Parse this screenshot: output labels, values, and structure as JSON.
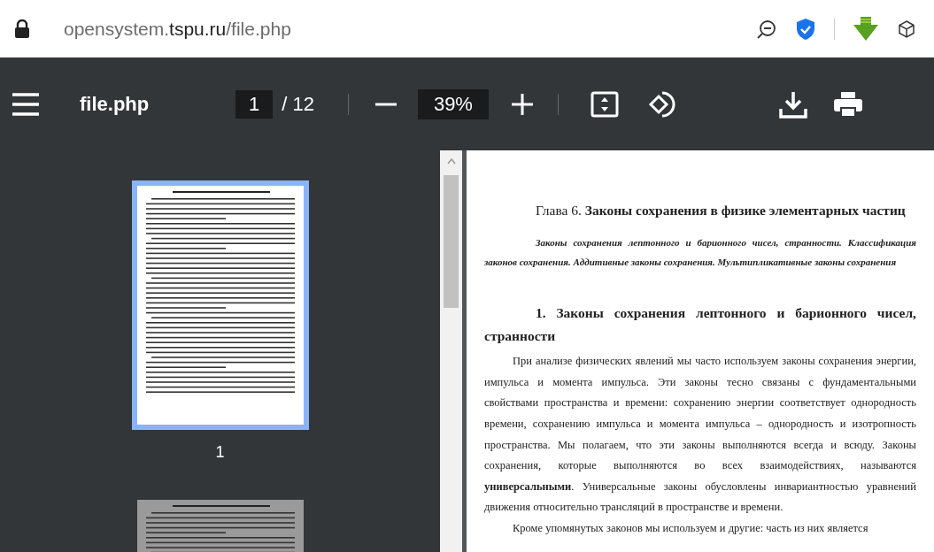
{
  "address_bar": {
    "url_host_prefix": "opensystem.",
    "url_domain": "tspu.ru",
    "url_path": "/file.php"
  },
  "toolbar": {
    "title": "file.php",
    "page_input": "1",
    "page_total": "/ 12",
    "zoom": "39%"
  },
  "thumbnails": [
    {
      "label": "1",
      "selected": true
    },
    {
      "selected": false
    }
  ],
  "document": {
    "heading": "Глава 6. **Законы сохранения в физике элементарных частиц**",
    "abstract": "Законы сохранения лептонного и барионного чисел, странности. Классификация законов сохранения. Аддитивные законы сохранения. Мультипликативные законы сохранения",
    "section_title": "1. Законы сохранения лептонного и барионного чисел, странности",
    "paragraphs": [
      "При анализе физических явлений мы часто используем законы сохранения энергии, импульса и момента импульса. Эти законы тесно связаны с фундаментальными свойствами пространства и времени: сохранению энергии соответствует однородность времени, сохранению импульса и момента импульса – однородность и изотропность пространства. Мы полагаем, что эти законы выполняются всегда и всюду. Законы сохранения, которые выполняются во всех взаимодействиях, называются **универсальными**. Универсальные законы обусловлены инвариантностью уравнений движения относительно трансляций в пространстве и времени.",
      "Кроме упомянутых законов мы используем и другие: часть из них является"
    ]
  }
}
